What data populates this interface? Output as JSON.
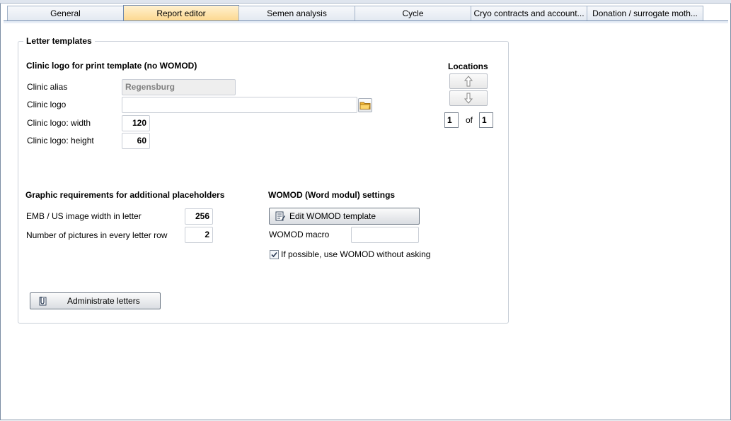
{
  "tabs": [
    {
      "label": "General",
      "active": false
    },
    {
      "label": "Report editor",
      "active": true
    },
    {
      "label": "Semen analysis",
      "active": false
    },
    {
      "label": "Cycle",
      "active": false
    },
    {
      "label": "Cryo contracts and account...",
      "active": false
    },
    {
      "label": "Donation / surrogate moth...",
      "active": false
    }
  ],
  "letter_templates": {
    "title": "Letter templates",
    "clinic_logo_section": {
      "title": "Clinic logo for print template (no WOMOD)",
      "alias_label": "Clinic alias",
      "alias_value": "Regensburg",
      "logo_label": "Clinic logo",
      "logo_value": "",
      "width_label": "Clinic logo: width",
      "width_value": "120",
      "height_label": "Clinic logo: height",
      "height_value": "60"
    },
    "locations": {
      "title": "Locations",
      "up_icon": "arrow-up-icon",
      "down_icon": "arrow-down-icon",
      "current": "1",
      "of_label": "of",
      "total": "1"
    },
    "graphic_section": {
      "title": "Graphic requirements for additional placeholders",
      "image_width_label": "EMB / US image width in letter",
      "image_width_value": "256",
      "pictures_label": "Number of pictures in every letter row",
      "pictures_value": "2"
    },
    "womod_section": {
      "title": "WOMOD (Word modul) settings",
      "edit_button": "Edit WOMOD template",
      "macro_label": "WOMOD macro",
      "macro_value": "",
      "use_womod_label": "If possible, use WOMOD without asking",
      "use_womod_checked": true
    },
    "administrate_button": "Administrate letters"
  },
  "colors": {
    "active_tab": "#fcd78e",
    "tab_border": "#6f89ad",
    "folder_icon": "#f2b632"
  }
}
